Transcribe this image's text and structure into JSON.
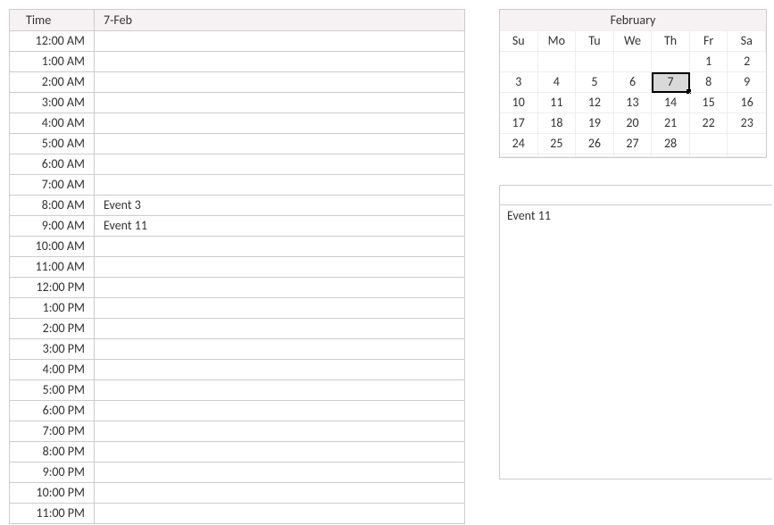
{
  "schedule": {
    "time_header": "Time",
    "date_header": "7-Feb",
    "rows": [
      {
        "time": "12:00 AM",
        "event": ""
      },
      {
        "time": "1:00 AM",
        "event": ""
      },
      {
        "time": "2:00 AM",
        "event": ""
      },
      {
        "time": "3:00 AM",
        "event": ""
      },
      {
        "time": "4:00 AM",
        "event": ""
      },
      {
        "time": "5:00 AM",
        "event": ""
      },
      {
        "time": "6:00 AM",
        "event": ""
      },
      {
        "time": "7:00 AM",
        "event": ""
      },
      {
        "time": "8:00 AM",
        "event": "Event 3"
      },
      {
        "time": "9:00 AM",
        "event": "Event 11"
      },
      {
        "time": "10:00 AM",
        "event": ""
      },
      {
        "time": "11:00 AM",
        "event": ""
      },
      {
        "time": "12:00 PM",
        "event": ""
      },
      {
        "time": "1:00 PM",
        "event": ""
      },
      {
        "time": "2:00 PM",
        "event": ""
      },
      {
        "time": "3:00 PM",
        "event": ""
      },
      {
        "time": "4:00 PM",
        "event": ""
      },
      {
        "time": "5:00 PM",
        "event": ""
      },
      {
        "time": "6:00 PM",
        "event": ""
      },
      {
        "time": "7:00 PM",
        "event": ""
      },
      {
        "time": "8:00 PM",
        "event": ""
      },
      {
        "time": "9:00 PM",
        "event": ""
      },
      {
        "time": "10:00 PM",
        "event": ""
      },
      {
        "time": "11:00 PM",
        "event": ""
      }
    ]
  },
  "calendar": {
    "title": "February",
    "day_headers": [
      "Su",
      "Mo",
      "Tu",
      "We",
      "Th",
      "Fr",
      "Sa"
    ],
    "selected": 7,
    "weeks": [
      [
        "",
        "",
        "",
        "",
        "",
        "1",
        "2"
      ],
      [
        "3",
        "4",
        "5",
        "6",
        "7",
        "8",
        "9"
      ],
      [
        "10",
        "11",
        "12",
        "13",
        "14",
        "15",
        "16"
      ],
      [
        "17",
        "18",
        "19",
        "20",
        "21",
        "22",
        "23"
      ],
      [
        "24",
        "25",
        "26",
        "27",
        "28",
        "",
        ""
      ],
      [
        "",
        "",
        "",
        "",
        "",
        "",
        ""
      ]
    ]
  },
  "detail": {
    "text": "Event 11"
  }
}
